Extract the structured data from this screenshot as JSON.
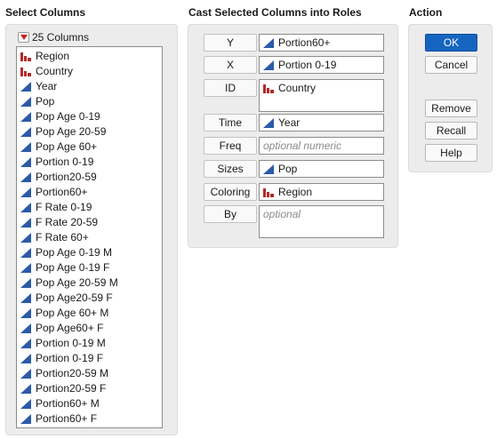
{
  "select_columns": {
    "title": "Select Columns",
    "count_label": "25 Columns",
    "items": [
      {
        "label": "Region",
        "icon": "nominal-bar-icon"
      },
      {
        "label": "Country",
        "icon": "nominal-bar-icon"
      },
      {
        "label": "Year",
        "icon": "continuous-triangle-icon"
      },
      {
        "label": "Pop",
        "icon": "continuous-triangle-icon"
      },
      {
        "label": "Pop Age 0-19",
        "icon": "continuous-triangle-icon"
      },
      {
        "label": "Pop Age 20-59",
        "icon": "continuous-triangle-icon"
      },
      {
        "label": "Pop Age 60+",
        "icon": "continuous-triangle-icon"
      },
      {
        "label": "Portion 0-19",
        "icon": "continuous-triangle-icon"
      },
      {
        "label": "Portion20-59",
        "icon": "continuous-triangle-icon"
      },
      {
        "label": "Portion60+",
        "icon": "continuous-triangle-icon"
      },
      {
        "label": "F Rate 0-19",
        "icon": "continuous-triangle-icon"
      },
      {
        "label": "F Rate 20-59",
        "icon": "continuous-triangle-icon"
      },
      {
        "label": "F Rate 60+",
        "icon": "continuous-triangle-icon"
      },
      {
        "label": "Pop Age 0-19 M",
        "icon": "continuous-triangle-icon"
      },
      {
        "label": "Pop Age 0-19 F",
        "icon": "continuous-triangle-icon"
      },
      {
        "label": "Pop Age 20-59 M",
        "icon": "continuous-triangle-icon"
      },
      {
        "label": "Pop Age20-59 F",
        "icon": "continuous-triangle-icon"
      },
      {
        "label": "Pop Age 60+ M",
        "icon": "continuous-triangle-icon"
      },
      {
        "label": "Pop Age60+ F",
        "icon": "continuous-triangle-icon"
      },
      {
        "label": "Portion 0-19 M",
        "icon": "continuous-triangle-icon"
      },
      {
        "label": "Portion 0-19 F",
        "icon": "continuous-triangle-icon"
      },
      {
        "label": "Portion20-59 M",
        "icon": "continuous-triangle-icon"
      },
      {
        "label": "Portion20-59 F",
        "icon": "continuous-triangle-icon"
      },
      {
        "label": "Portion60+ M",
        "icon": "continuous-triangle-icon"
      },
      {
        "label": "Portion60+ F",
        "icon": "continuous-triangle-icon"
      }
    ]
  },
  "roles": {
    "title": "Cast Selected Columns into Roles",
    "items": [
      {
        "button": "Y",
        "value": "Portion60+",
        "icon": "continuous-triangle-icon",
        "placeholder": ""
      },
      {
        "button": "X",
        "value": "Portion 0-19",
        "icon": "continuous-triangle-icon",
        "placeholder": ""
      },
      {
        "button": "ID",
        "value": "Country",
        "icon": "nominal-bar-icon",
        "placeholder": ""
      },
      {
        "button": "Time",
        "value": "Year",
        "icon": "continuous-triangle-icon",
        "placeholder": ""
      },
      {
        "button": "Freq",
        "value": "",
        "icon": "",
        "placeholder": "optional numeric"
      },
      {
        "button": "Sizes",
        "value": "Pop",
        "icon": "continuous-triangle-icon",
        "placeholder": ""
      },
      {
        "button": "Coloring",
        "value": "Region",
        "icon": "nominal-bar-icon",
        "placeholder": ""
      },
      {
        "button": "By",
        "value": "",
        "icon": "",
        "placeholder": "optional"
      }
    ]
  },
  "action": {
    "title": "Action",
    "buttons": [
      "OK",
      "Cancel",
      "Remove",
      "Recall",
      "Help"
    ]
  },
  "colors": {
    "continuous_icon": "#2b5aa8",
    "nominal_icon": "#b5282a",
    "ok_button": "#1565c0"
  }
}
